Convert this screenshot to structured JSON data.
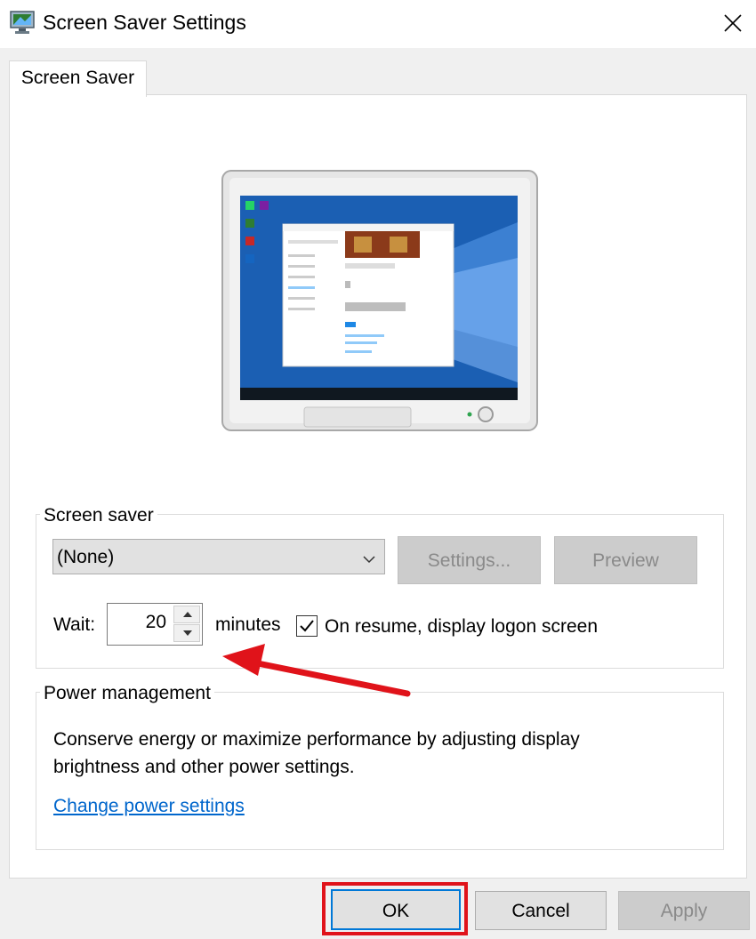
{
  "window": {
    "title": "Screen Saver Settings",
    "icon": "display-settings-icon",
    "close_icon": "close-icon"
  },
  "tabs": [
    {
      "label": "Screen Saver",
      "selected": true
    }
  ],
  "preview": {
    "image": "monitor-preview-image"
  },
  "screen_saver": {
    "group_label": "Screen saver",
    "selected": "(None)",
    "settings_label": "Settings...",
    "preview_label": "Preview",
    "wait_label": "Wait:",
    "wait_value": "20",
    "minutes_label": "minutes",
    "resume_label": "On resume, display logon screen",
    "resume_checked": true
  },
  "power": {
    "group_label": "Power management",
    "description": "Conserve energy or maximize performance by adjusting display brightness and other power settings.",
    "link_label": "Change power settings"
  },
  "buttons": {
    "ok": "OK",
    "cancel": "Cancel",
    "apply": "Apply"
  },
  "annotation": {
    "highlight_color": "#e0131a"
  },
  "colors": {
    "link": "#0066cc",
    "desktop_blue": "#1b5fb3"
  }
}
